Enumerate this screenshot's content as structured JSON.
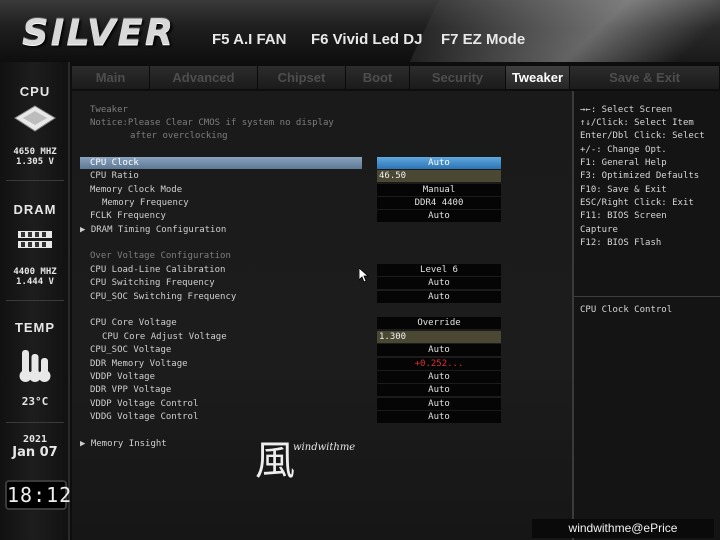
{
  "header": {
    "logo": "SILVER",
    "hotkeys": [
      "F5 A.I FAN",
      "F6 Vivid Led DJ",
      "F7 EZ Mode"
    ]
  },
  "sidebar": {
    "cpu": {
      "title": "CPU",
      "freq": "4650 MHZ",
      "volt": "1.305 V"
    },
    "dram": {
      "title": "DRAM",
      "freq": "4400 MHZ",
      "volt": "1.444 V"
    },
    "temp": {
      "title": "TEMP",
      "value": "23°C"
    },
    "date": {
      "year": "2021",
      "day": "Jan 07"
    },
    "time": "18:12"
  },
  "tabs": [
    "Main",
    "Advanced",
    "Chipset",
    "Boot",
    "Security",
    "Tweaker",
    "Save & Exit"
  ],
  "active_tab": "Tweaker",
  "main": {
    "section": "Tweaker",
    "notice_line1": "Notice:Please Clear CMOS if system no display",
    "notice_line2": "after overclocking",
    "settings": [
      {
        "label": "CPU Clock",
        "value": "Auto"
      },
      {
        "label": "CPU Ratio",
        "value": "46.50"
      },
      {
        "label": "Memory Clock Mode",
        "value": "Manual"
      },
      {
        "label": "Memory Frequency",
        "value": "DDR4 4400"
      },
      {
        "label": "FCLK Frequency",
        "value": "Auto"
      },
      {
        "label": "DRAM Timing Configuration"
      },
      {
        "label": "Over Voltage Configuration"
      },
      {
        "label": "CPU Load-Line Calibration",
        "value": "Level 6"
      },
      {
        "label": "CPU Switching Frequency",
        "value": "Auto"
      },
      {
        "label": "CPU_SOC Switching Frequency",
        "value": "Auto"
      },
      {
        "label": "CPU Core Voltage",
        "value": "Override"
      },
      {
        "label": "CPU Core Adjust Voltage",
        "value": "1.300"
      },
      {
        "label": "CPU_SOC Voltage",
        "value": "Auto"
      },
      {
        "label": "DDR Memory Voltage",
        "value": "+0.252..."
      },
      {
        "label": "VDDP Voltage",
        "value": "Auto"
      },
      {
        "label": "DDR VPP Voltage",
        "value": "Auto"
      },
      {
        "label": "VDDP Voltage Control",
        "value": "Auto"
      },
      {
        "label": "VDDG Voltage Control",
        "value": "Auto"
      },
      {
        "label": "Memory Insight"
      }
    ]
  },
  "help": {
    "keys": [
      "→←: Select Screen",
      "↑↓/Click: Select Item",
      "Enter/Dbl Click: Select",
      "+/-: Change Opt.",
      "F1: General Help",
      "F3: Optimized Defaults",
      "F10: Save & Exit",
      "ESC/Right Click: Exit",
      "F11: BIOS Screen",
      "Capture",
      "F12: BIOS Flash"
    ],
    "description": "CPU Clock Control"
  },
  "watermark": {
    "glyph": "風",
    "text": "windwithme",
    "bar": "windwithme@ePrice"
  },
  "colors": {
    "accent": "#2d74b4",
    "selected_row": "#7590ad",
    "warn": "#e03030"
  }
}
